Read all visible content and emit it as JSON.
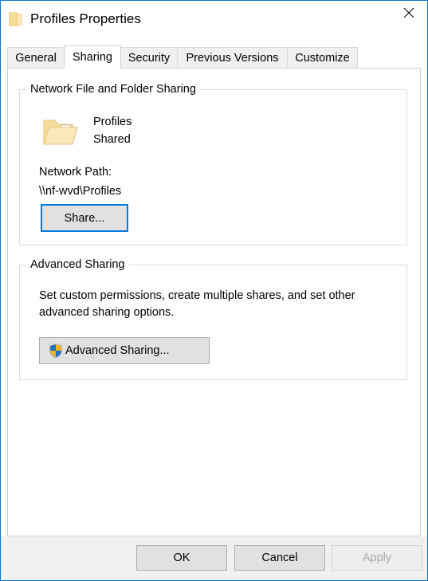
{
  "window": {
    "title": "Profiles Properties",
    "title_icon": "folder-icon",
    "close_icon": "close-icon",
    "accent_color": "#0078d7"
  },
  "tabs": [
    {
      "label": "General",
      "active": false
    },
    {
      "label": "Sharing",
      "active": true
    },
    {
      "label": "Security",
      "active": false
    },
    {
      "label": "Previous Versions",
      "active": false
    },
    {
      "label": "Customize",
      "active": false
    }
  ],
  "network_sharing": {
    "legend": "Network File and Folder Sharing",
    "folder_icon": "shared-folder-icon",
    "share_name": "Profiles",
    "share_state": "Shared",
    "path_label": "Network Path:",
    "path_value": "\\\\nf-wvd\\Profiles",
    "share_button": "Share..."
  },
  "advanced_sharing": {
    "legend": "Advanced Sharing",
    "description": "Set custom permissions, create multiple shares, and set other advanced sharing options.",
    "button_label": "Advanced Sharing...",
    "button_icon": "uac-shield-icon"
  },
  "footer": {
    "ok_label": "OK",
    "cancel_label": "Cancel",
    "apply_label": "Apply"
  }
}
